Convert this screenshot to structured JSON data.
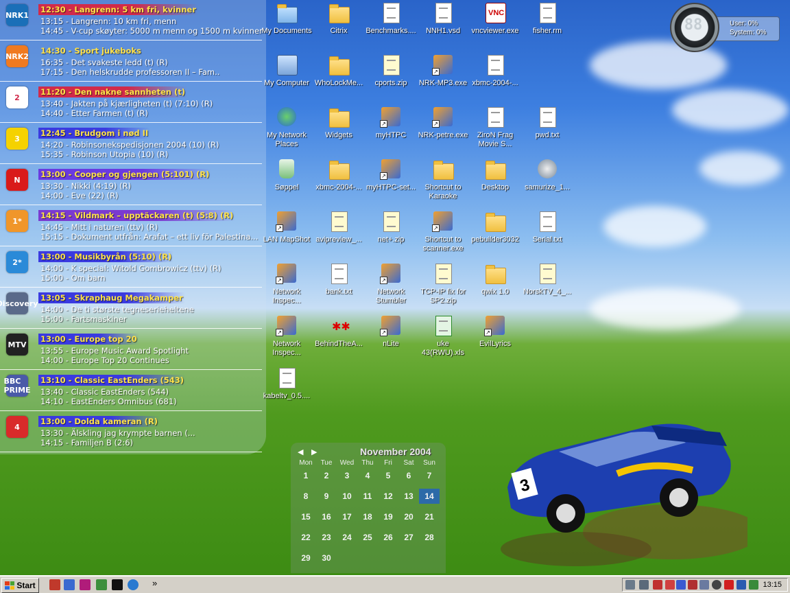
{
  "tvguide": {
    "channels": [
      {
        "logo": "NRK1",
        "color": "#1a6fb8",
        "now": "12:30 - Langrenn: 5 km fri, kvinner",
        "now_bg": "#d12a4a",
        "next": [
          "13:15 - Langrenn: 10 km fri, menn",
          "14:45 - V-cup skøyter: 5000 m menn og 1500 m kvinner"
        ]
      },
      {
        "logo": "NRK2",
        "color": "#f07a20",
        "now": "14:30 - Sport jukeboks",
        "now_bg": "",
        "next": [
          "16:35 - Det svakeste ledd (t) (R)",
          "17:15 - Den helskrudde professoren II – Fam.."
        ]
      },
      {
        "logo": "2",
        "color": "#ffffff",
        "now": "11:20 - Den nakne sannheten (t)",
        "now_bg": "#d12a4a",
        "next": [
          "13:40 - Jakten på kjærligheten (t)  (7:10) (R)",
          "14:40 - Etter Farmen (t) (R)"
        ]
      },
      {
        "logo": "3",
        "color": "#f5d200",
        "now": "12:45 - Brudgom i nød II",
        "now_bg": "#3a3ae0",
        "next": [
          "14:20 - Robinsonekspedisjonen 2004 (10) (R)",
          "15:35 - Robinson Utopia (10) (R)"
        ]
      },
      {
        "logo": "N",
        "color": "#d91a1a",
        "now": "13:00 - Cooper og gjengen (5:101) (R)",
        "now_bg": "#6a3ae0",
        "next": [
          "13:30 - Nikki (4:19) (R)",
          "14:00 - Eve (22) (R)"
        ]
      },
      {
        "logo": "1*",
        "color": "#f0962a",
        "now": "14:15 - Vildmark – upptäckaren (t)  (5:8) (R)",
        "now_bg": "#7a3ad0",
        "next": [
          "14:45 - Mitt i naturen (ttv) (R)",
          "15:15 - Dokument utfrån: Arafat – ett liv för Palestina..."
        ]
      },
      {
        "logo": "2*",
        "color": "#2a8ad8",
        "now": "13:00 - Musikbyrån (5:10) (R)",
        "now_bg": "#3a3ae0",
        "next": [
          "14:00 - K special: Witold Gombrowicz (ttv) (R)",
          "15:00 - Om barn"
        ]
      },
      {
        "logo": "Discovery",
        "color": "#5a6a8a",
        "now": "13:05 - Skraphaug Megakamper",
        "now_bg": "#3a3ae0",
        "next": [
          "14:00 - De ti største tegneserieheltene",
          "15:00 - Fartsmaskiner"
        ]
      },
      {
        "logo": "MTV",
        "color": "#222222",
        "now": "13:00 - Europe top 20",
        "now_bg": "#3a3ae0",
        "next": [
          "13:55 - Europe Music Award Spotlight",
          "14:00 - Europe Top 20 Continues"
        ]
      },
      {
        "logo": "BBC PRIME",
        "color": "#4a5aa8",
        "now": "13:10 - Classic EastEnders (543)",
        "now_bg": "#3a3ae0",
        "next": [
          "13:40 - Classic EastEnders (544)",
          "14:10 - EastEnders Omnibus (681)"
        ]
      },
      {
        "logo": "4",
        "color": "#d92a2a",
        "now": "13:00 - Dolda kameran (R)",
        "now_bg": "#3a3ae0",
        "next": [
          "13:30 - Älskling jag krympte barnen (...",
          "14:15 - Familjen B (2:6)"
        ]
      }
    ]
  },
  "desktop": {
    "icons": [
      {
        "label": "My Documents",
        "kind": "mydocs"
      },
      {
        "label": "Citrix",
        "kind": "folder"
      },
      {
        "label": "Benchmarks....",
        "kind": "doc"
      },
      {
        "label": "NNH1.vsd",
        "kind": "doc"
      },
      {
        "label": "vncviewer.exe",
        "kind": "vnc"
      },
      {
        "label": "fisher.rm",
        "kind": "doc"
      },
      {
        "label": "My Computer",
        "kind": "computer"
      },
      {
        "label": "WhoLockMe...",
        "kind": "folder"
      },
      {
        "label": "cports.zip",
        "kind": "zip"
      },
      {
        "label": "NRK-MP3.exe",
        "kind": "shortcut-app"
      },
      {
        "label": "xbmc-2004-...",
        "kind": "doc"
      },
      {
        "label": "",
        "kind": "none"
      },
      {
        "label": "My Network Places",
        "kind": "network"
      },
      {
        "label": "Widgets",
        "kind": "folder"
      },
      {
        "label": "myHTPC",
        "kind": "shortcut-app"
      },
      {
        "label": "NRK-petre.exe",
        "kind": "shortcut-app"
      },
      {
        "label": "ZiroN Frag Movie S...",
        "kind": "doc"
      },
      {
        "label": "pwd.txt",
        "kind": "doc"
      },
      {
        "label": "Søppel",
        "kind": "bin"
      },
      {
        "label": "xbmc-2004-...",
        "kind": "folder"
      },
      {
        "label": "myHTPC-set...",
        "kind": "shortcut-app"
      },
      {
        "label": "Shortcut to Karaoke",
        "kind": "folder"
      },
      {
        "label": "Desktop",
        "kind": "folder"
      },
      {
        "label": "samurize_1...",
        "kind": "samurize"
      },
      {
        "label": "LAN MapShot",
        "kind": "shortcut-app"
      },
      {
        "label": "avipreview_...",
        "kind": "zip"
      },
      {
        "label": "net+.zip",
        "kind": "zip"
      },
      {
        "label": "Shortcut to scanner.exe",
        "kind": "shortcut-app"
      },
      {
        "label": "pebuilder3032",
        "kind": "folder"
      },
      {
        "label": "Serial.txt",
        "kind": "doc"
      },
      {
        "label": "Network Inspec...",
        "kind": "shortcut-app"
      },
      {
        "label": "bank.txt",
        "kind": "doc"
      },
      {
        "label": "Network Stumbler",
        "kind": "shortcut-app"
      },
      {
        "label": "TCP-IP fix for SP2.zip",
        "kind": "zip"
      },
      {
        "label": "qwix 1.0",
        "kind": "folder"
      },
      {
        "label": "NorskTV_4_...",
        "kind": "zip"
      },
      {
        "label": "Network Inspec...",
        "kind": "shortcut-app"
      },
      {
        "label": "BehindTheA...",
        "kind": "app"
      },
      {
        "label": "nLite",
        "kind": "shortcut-app"
      },
      {
        "label": "uke 43(RWU).xls",
        "kind": "xls"
      },
      {
        "label": "EvilLyrics",
        "kind": "shortcut-app"
      },
      {
        "label": "",
        "kind": "none"
      },
      {
        "label": "kabeltv_0.5....",
        "kind": "doc"
      }
    ]
  },
  "cpu": {
    "digits": "88",
    "user": "User: 0%",
    "system": "System: 0%"
  },
  "calendar": {
    "title": "November 2004",
    "weekdays": [
      "Mon",
      "Tue",
      "Wed",
      "Thu",
      "Fri",
      "Sat",
      "Sun"
    ],
    "days": [
      "1",
      "2",
      "3",
      "4",
      "5",
      "6",
      "7",
      "8",
      "9",
      "10",
      "11",
      "12",
      "13",
      "14",
      "15",
      "16",
      "17",
      "18",
      "19",
      "20",
      "21",
      "22",
      "23",
      "24",
      "25",
      "26",
      "27",
      "28",
      "29",
      "30"
    ],
    "today": "14",
    "nav_prev": "◀",
    "nav_next": "▶"
  },
  "taskbar": {
    "start": "Start",
    "clock": "13:15",
    "more": "»"
  }
}
